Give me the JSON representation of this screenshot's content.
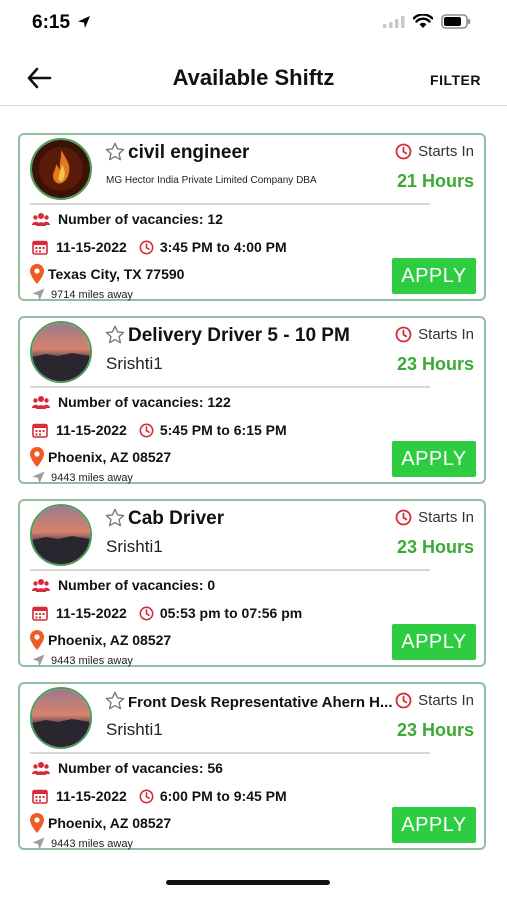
{
  "status_bar": {
    "time": "6:15"
  },
  "header": {
    "title": "Available Shiftz",
    "filter_label": "FILTER"
  },
  "common": {
    "starts_in_label": "Starts In",
    "apply_label": "APPLY",
    "vacancies_prefix": "Number of vacancies: "
  },
  "colors": {
    "accent_green": "#2ecc40",
    "hours_green": "#3aaa35",
    "icon_red": "#d62b3a",
    "card_border": "#8fbf9f"
  },
  "cards": [
    {
      "title": "civil engineer",
      "company": "MG Hector India Private Limited Company DBA",
      "hours": "21 Hours",
      "vacancies": "Number of vacancies: 12",
      "date": "11-15-2022",
      "time": "3:45 PM to 4:00 PM",
      "location": "Texas City, TX 77590",
      "distance": "9714 miles away",
      "avatar": "fire-logo"
    },
    {
      "title": "Delivery Driver 5 - 10 PM",
      "company": "Srishti1",
      "hours": "23 Hours",
      "vacancies": "Number of vacancies: 122",
      "date": "11-15-2022",
      "time": "5:45 PM to 6:15 PM",
      "location": "Phoenix, AZ 08527",
      "distance": "9443 miles away",
      "avatar": "sunset-photo"
    },
    {
      "title": "Cab Driver",
      "company": "Srishti1",
      "hours": "23 Hours",
      "vacancies": "Number of vacancies: 0",
      "date": "11-15-2022",
      "time": "05:53 pm to 07:56 pm",
      "location": "Phoenix, AZ 08527",
      "distance": "9443 miles away",
      "avatar": "sunset-photo"
    },
    {
      "title": "Front Desk Representative Ahern H...",
      "company": "Srishti1",
      "hours": "23 Hours",
      "vacancies": "Number of vacancies: 56",
      "date": "11-15-2022",
      "time": "6:00 PM to 9:45 PM",
      "location": "Phoenix, AZ 08527",
      "distance": "9443 miles away",
      "avatar": "sunset-photo"
    }
  ]
}
